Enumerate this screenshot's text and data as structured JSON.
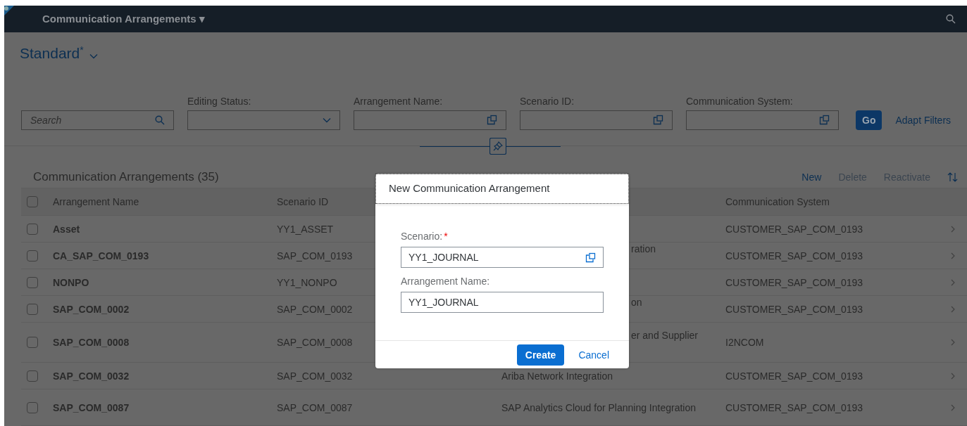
{
  "shell": {
    "title": "Communication Arrangements ▾"
  },
  "variant": {
    "name": "Standard",
    "modified_mark": "*"
  },
  "filters": [
    {
      "kind": "search",
      "placeholder": "Search"
    },
    {
      "kind": "select",
      "label": "Editing Status:"
    },
    {
      "kind": "valuehelp",
      "label": "Arrangement Name:"
    },
    {
      "kind": "valuehelp",
      "label": "Scenario ID:"
    },
    {
      "kind": "valuehelp",
      "label": "Communication System:"
    }
  ],
  "go_button": "Go",
  "adapt_filters": "Adapt Filters",
  "table": {
    "title": "Communication Arrangements (35)",
    "actions": [
      {
        "label": "New",
        "disabled": false
      },
      {
        "label": "Delete",
        "disabled": true
      },
      {
        "label": "Reactivate",
        "disabled": true
      }
    ],
    "columns": [
      "Arrangement Name",
      "Scenario ID",
      "Communication System"
    ],
    "all_checked": false,
    "rows": [
      {
        "name": "Asset",
        "scenario": "YY1_ASSET",
        "description": null,
        "system": "CUSTOMER_SAP_COM_0193",
        "checked": false
      },
      {
        "name": "CA_SAP_COM_0193",
        "scenario": "SAP_COM_0193",
        "description": {
          "text": "ration",
          "covered": true
        },
        "system": "CUSTOMER_SAP_COM_0193",
        "checked": false
      },
      {
        "name": "NONPO",
        "scenario": "YY1_NONPO",
        "description": null,
        "system": "CUSTOMER_SAP_COM_0193",
        "checked": false
      },
      {
        "name": "SAP_COM_0002",
        "scenario": "SAP_COM_0002",
        "description": {
          "text": "on",
          "covered": true
        },
        "system": "CUSTOMER_SAP_COM_0193",
        "checked": false
      },
      {
        "name": "SAP_COM_0008",
        "scenario": "SAP_COM_0008",
        "description": {
          "text": "er and Supplier",
          "covered": true
        },
        "system": "I2NCOM",
        "checked": false
      },
      {
        "name": "SAP_COM_0032",
        "scenario": "SAP_COM_0032",
        "description": {
          "text": "Ariba Network Integration",
          "covered": false
        },
        "system": "CUSTOMER_SAP_COM_0193",
        "checked": false
      },
      {
        "name": "SAP_COM_0087",
        "scenario": "SAP_COM_0087",
        "description": {
          "text": "SAP Analytics Cloud for Planning Integration",
          "covered": false
        },
        "system": "CUSTOMER_SAP_COM_0193",
        "checked": false
      }
    ]
  },
  "dialog": {
    "title": "New Communication Arrangement",
    "fields": [
      {
        "label": "Scenario:",
        "required": true,
        "value": "YY1_JOURNAL",
        "value_help": true
      },
      {
        "label": "Arrangement Name:",
        "required": false,
        "value": "YY1_JOURNAL",
        "value_help": false
      }
    ],
    "buttons": [
      {
        "label": "Create",
        "kind": "primary"
      },
      {
        "label": "Cancel",
        "kind": "link"
      }
    ]
  }
}
